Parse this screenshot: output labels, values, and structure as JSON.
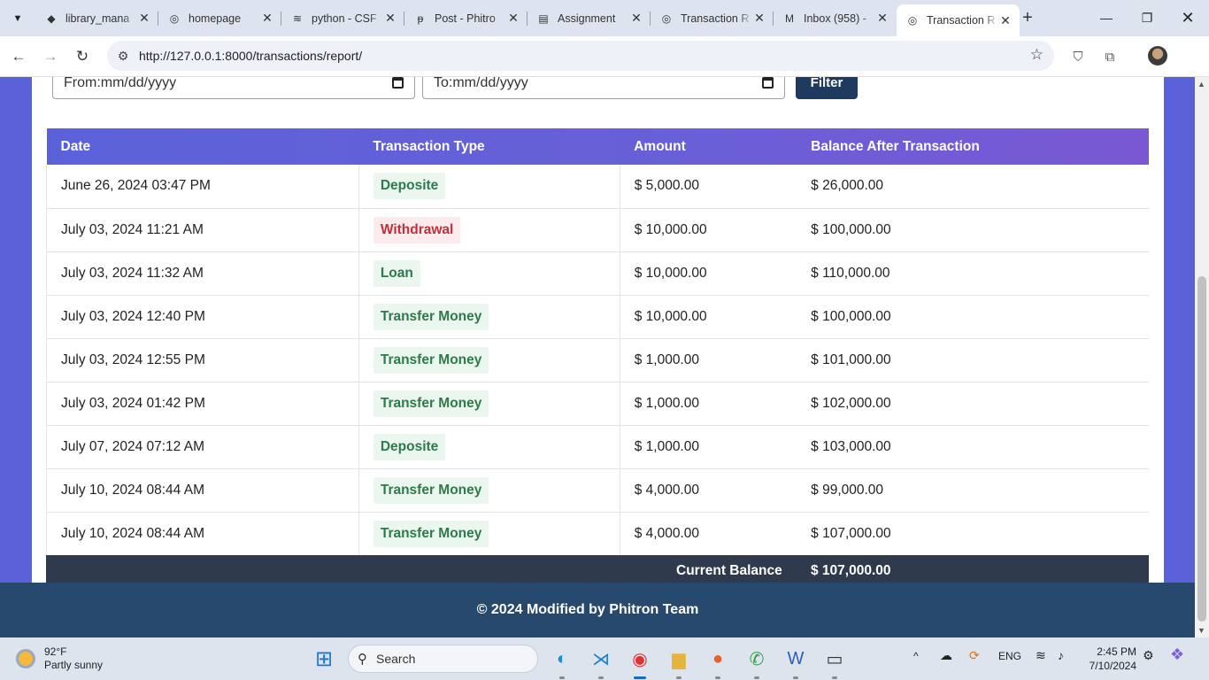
{
  "browser": {
    "tabs": [
      {
        "title": "library_mana",
        "icon": "github-icon",
        "icon_glyph": "◆"
      },
      {
        "title": "homepage",
        "icon": "globe-icon",
        "icon_glyph": "◎"
      },
      {
        "title": "python - CSF",
        "icon": "stackoverflow-icon",
        "icon_glyph": "≋"
      },
      {
        "title": "Post - Phitro",
        "icon": "phitron-icon",
        "icon_glyph": "ᵽ"
      },
      {
        "title": "Assignment",
        "icon": "docs-icon",
        "icon_glyph": "▤"
      },
      {
        "title": "Transaction R",
        "icon": "globe-icon",
        "icon_glyph": "◎"
      },
      {
        "title": "Inbox (958) -",
        "icon": "gmail-icon",
        "icon_glyph": "M"
      },
      {
        "title": "Transaction R",
        "icon": "globe-icon",
        "icon_glyph": "◎"
      }
    ],
    "url": "http://127.0.0.1:8000/transactions/report/"
  },
  "filter": {
    "from_placeholder": "From:mm/dd/yyyy",
    "to_placeholder": "To:mm/dd/yyyy",
    "button_label": "Filter"
  },
  "table": {
    "headers": [
      "Date",
      "Transaction Type",
      "Amount",
      "Balance After Transaction"
    ],
    "rows": [
      {
        "date": "June 26, 2024 03:47 PM",
        "type": "Deposite",
        "type_color": "green",
        "amount": "$ 5,000.00",
        "balance": "$ 26,000.00"
      },
      {
        "date": "July 03, 2024 11:21 AM",
        "type": "Withdrawal",
        "type_color": "red",
        "amount": "$ 10,000.00",
        "balance": "$ 100,000.00"
      },
      {
        "date": "July 03, 2024 11:32 AM",
        "type": "Loan",
        "type_color": "green",
        "amount": "$ 10,000.00",
        "balance": "$ 110,000.00"
      },
      {
        "date": "July 03, 2024 12:40 PM",
        "type": "Transfer Money",
        "type_color": "green",
        "amount": "$ 10,000.00",
        "balance": "$ 100,000.00"
      },
      {
        "date": "July 03, 2024 12:55 PM",
        "type": "Transfer Money",
        "type_color": "green",
        "amount": "$ 1,000.00",
        "balance": "$ 101,000.00"
      },
      {
        "date": "July 03, 2024 01:42 PM",
        "type": "Transfer Money",
        "type_color": "green",
        "amount": "$ 1,000.00",
        "balance": "$ 102,000.00"
      },
      {
        "date": "July 07, 2024 07:12 AM",
        "type": "Deposite",
        "type_color": "green",
        "amount": "$ 1,000.00",
        "balance": "$ 103,000.00"
      },
      {
        "date": "July 10, 2024 08:44 AM",
        "type": "Transfer Money",
        "type_color": "green",
        "amount": "$ 4,000.00",
        "balance": "$ 99,000.00"
      },
      {
        "date": "July 10, 2024 08:44 AM",
        "type": "Transfer Money",
        "type_color": "green",
        "amount": "$ 4,000.00",
        "balance": "$ 107,000.00"
      }
    ],
    "current_balance_label": "Current Balance",
    "current_balance_value": "$ 107,000.00"
  },
  "footer": {
    "text": "© 2024 Modified by Phitron Team"
  },
  "taskbar": {
    "weather_temp": "92°F",
    "weather_desc": "Partly sunny",
    "search_label": "Search",
    "lang": "ENG",
    "time": "2:45 PM",
    "date": "7/10/2024"
  },
  "colors": {
    "page_bg": "#5b62d9",
    "header_gradient_start": "#5b62d9",
    "header_gradient_end": "#7a58d4",
    "filter_button": "#1f3a5f",
    "footer_bg": "#27496d",
    "balance_row_bg": "#2f3a4c",
    "badge_green_text": "#2d7a4b",
    "badge_red_text": "#c0303a"
  }
}
